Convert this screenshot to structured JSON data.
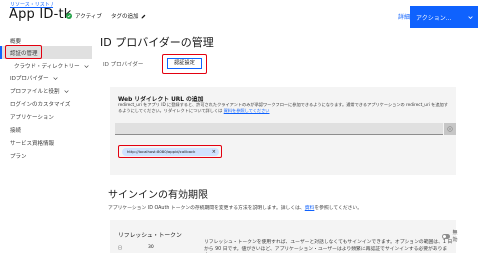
{
  "header": {
    "breadcrumb": "リソース・リスト /",
    "app_title": "App ID-tk",
    "status": "アクティブ",
    "add_tag": "タグの追加",
    "details_link": "詳細",
    "actions_label": "アクション..."
  },
  "sidebar": {
    "items": [
      {
        "label": "概要"
      },
      {
        "label": "認証の管理"
      },
      {
        "label": "クラウド・ディレクトリー"
      },
      {
        "label": "IDプロバイダー"
      },
      {
        "label": "プロファイルと役割"
      },
      {
        "label": "ログインのカスタマイズ"
      },
      {
        "label": "アプリケーション"
      },
      {
        "label": "接続"
      },
      {
        "label": "サービス資格情報"
      },
      {
        "label": "プラン"
      }
    ]
  },
  "main": {
    "page_title": "ID プロバイダーの管理",
    "tabs": [
      {
        "label": "ID プロバイダー"
      },
      {
        "label": "認証設定"
      }
    ],
    "redirect_panel": {
      "title": "Web リダイレクト URL の追加",
      "desc": "redirect_uri をアプリ ID に登録すると、許可されたクライアントのみが承認ワークフローに参加できるようになります。通常できるアプリケーションの redirect_uri を追加するようにしてください。リダイレクトについて詳しくは",
      "desc_link": "資料を参照してください",
      "url_chip": "http://localhost:8080/appid/callback",
      "chip_close": "×"
    },
    "signin_section": {
      "title": "サインインの有効期限",
      "desc": "アプリケーション ID OAuth トークンの存続期間を変更する方法を説明します。詳しくは、",
      "desc_link": "資料",
      "desc_suffix": "を参照してください。"
    },
    "refresh_panel": {
      "title": "リフレッシュ・トークン",
      "status": "無効",
      "help": "リフレッシュ・トークンを使用すれば、ユーザーと対話しなくてもサインインできます。オプションの範囲は、1 日から 90 日です。値がさいほど、アプリケーション・ユーザーはより頻繁に再認証でサインインする必要があります。",
      "stepper_label": "日",
      "stepper_value": "30"
    }
  },
  "colors": {
    "accent": "#0f62fe",
    "highlight": "#e3000f",
    "status_active": "#24a148"
  }
}
